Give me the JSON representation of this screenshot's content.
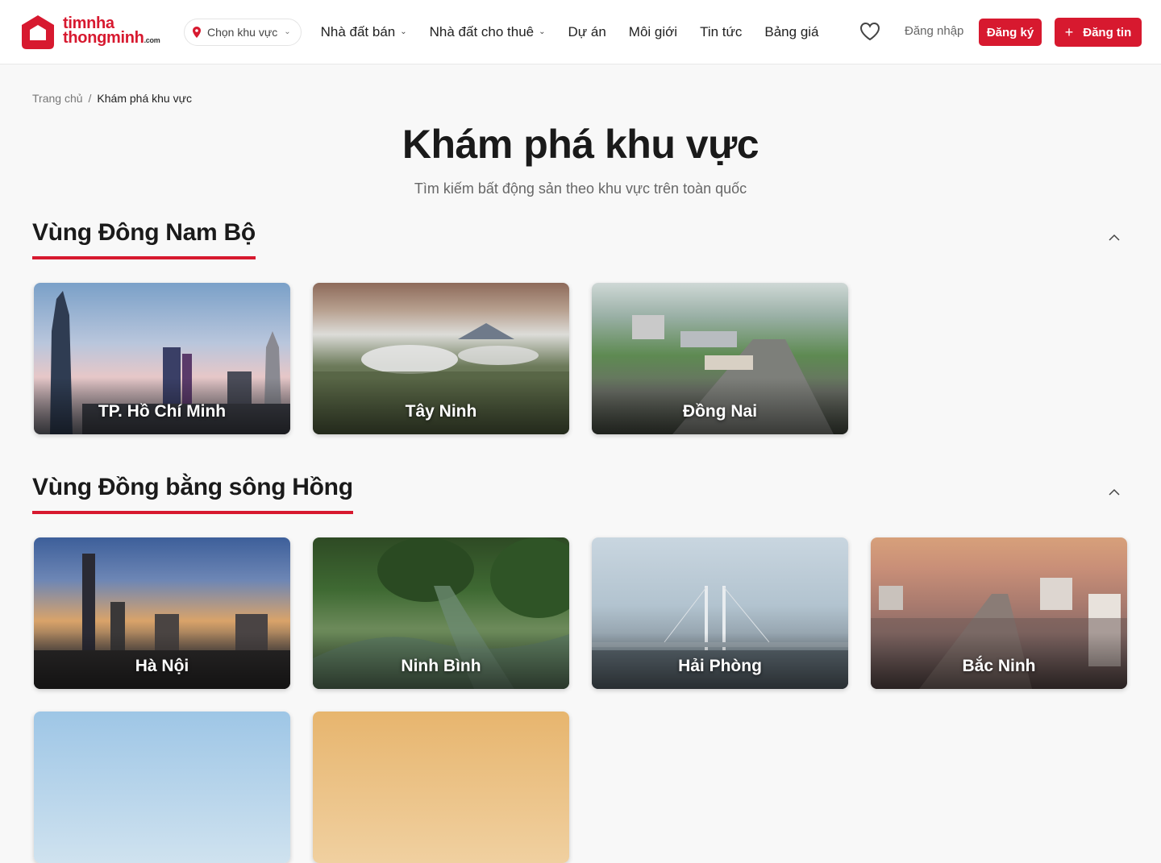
{
  "brand": {
    "line1": "timnha",
    "line2": "thongminh",
    "suffix": ".com"
  },
  "header": {
    "region_select": "Chọn khu vực",
    "nav": [
      {
        "label": "Nhà đất bán",
        "has_dropdown": true
      },
      {
        "label": "Nhà đất cho thuê",
        "has_dropdown": true
      },
      {
        "label": "Dự án",
        "has_dropdown": false
      },
      {
        "label": "Môi giới",
        "has_dropdown": false
      },
      {
        "label": "Tin tức",
        "has_dropdown": false
      },
      {
        "label": "Bảng giá",
        "has_dropdown": false
      }
    ],
    "favorites_icon": "heart-icon",
    "login": "Đăng nhập",
    "register": "Đăng ký",
    "post": "Đăng tin"
  },
  "breadcrumb": {
    "home": "Trang chủ",
    "separator": "/",
    "current": "Khám phá khu vực"
  },
  "page": {
    "title": "Khám phá khu vực",
    "subtitle": "Tìm kiếm bất động sản theo khu vực trên toàn quốc"
  },
  "sections": [
    {
      "title": "Vùng Đông Nam Bộ",
      "regions": [
        "TP. Hồ Chí Minh",
        "Tây Ninh",
        "Đồng Nai"
      ]
    },
    {
      "title": "Vùng Đồng bằng sông Hồng",
      "regions": [
        "Hà Nội",
        "Ninh Bình",
        "Hải Phòng",
        "Bắc Ninh"
      ]
    }
  ],
  "colors": {
    "accent": "#d7192f",
    "background": "#f8f8f8",
    "header_bg": "#ffffff"
  }
}
